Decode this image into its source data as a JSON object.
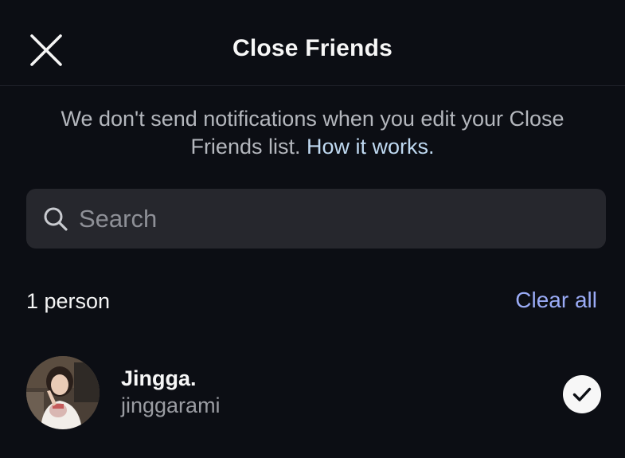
{
  "header": {
    "title": "Close Friends",
    "close_icon": "close-icon"
  },
  "notice": {
    "text": "We don't send notifications when you edit your Close Friends list.",
    "link": "How it works."
  },
  "search": {
    "placeholder": "Search",
    "value": "",
    "icon": "search-icon"
  },
  "list": {
    "count_label": "1 person",
    "clear_all_label": "Clear all",
    "friends": [
      {
        "display_name": "Jingga.",
        "username": "jinggarami",
        "selected": true,
        "check_icon": "checkmark-icon"
      }
    ]
  },
  "colors": {
    "background": "#0c0e14",
    "search_bg": "#26272d",
    "link": "#bfd9f1",
    "accent": "#9aabf6"
  }
}
